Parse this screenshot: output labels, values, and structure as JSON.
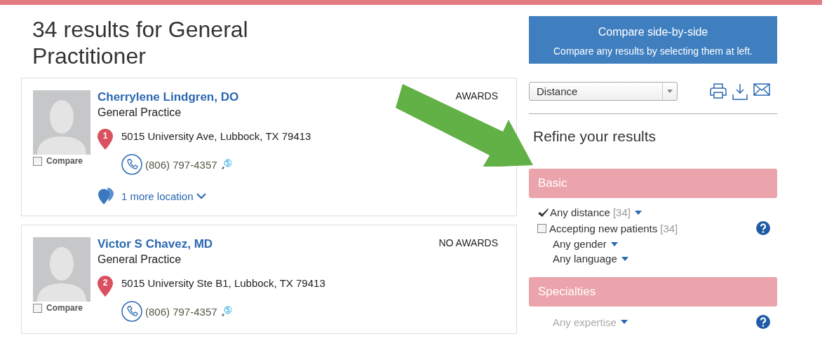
{
  "results_title": "34 results for General Practitioner",
  "results": [
    {
      "name": "Cherrylene Lindgren, DO",
      "specialty": "General Practice",
      "awards": "AWARDS",
      "compare_label": "Compare",
      "compare_checked": false,
      "pin": "1",
      "address": "5015 University Ave, Lubbock, TX 79413",
      "phone": "(806) 797-4357",
      "more_locations": "1 more location"
    },
    {
      "name": "Victor S Chavez, MD",
      "specialty": "General Practice",
      "awards": "NO AWARDS",
      "compare_label": "Compare",
      "compare_checked": false,
      "pin": "2",
      "address": "5015 University Ste B1, Lubbock, TX 79413",
      "phone": "(806) 797-4357"
    }
  ],
  "compare_panel": {
    "title": "Compare side-by-side",
    "subtitle": "Compare any results by selecting them at left."
  },
  "sort": {
    "value": "Distance"
  },
  "refine_title": "Refine your results",
  "sections": [
    {
      "title": "Basic",
      "filters": [
        {
          "kind": "toggle",
          "label": "Any distance",
          "count": "[34]",
          "checked": true,
          "dropdown": true,
          "help": false,
          "disabled": false
        },
        {
          "kind": "toggle",
          "label": "Accepting new patients",
          "count": "[34]",
          "checked": false,
          "dropdown": false,
          "help": true,
          "disabled": false
        },
        {
          "kind": "plain",
          "label": "Any gender",
          "dropdown": true,
          "help": false,
          "disabled": false
        },
        {
          "kind": "plain",
          "label": "Any language",
          "dropdown": true,
          "help": false,
          "disabled": false
        }
      ]
    },
    {
      "title": "Specialties",
      "filters": [
        {
          "kind": "plain",
          "label": "Any expertise",
          "dropdown": true,
          "help": true,
          "disabled": true
        }
      ]
    }
  ]
}
